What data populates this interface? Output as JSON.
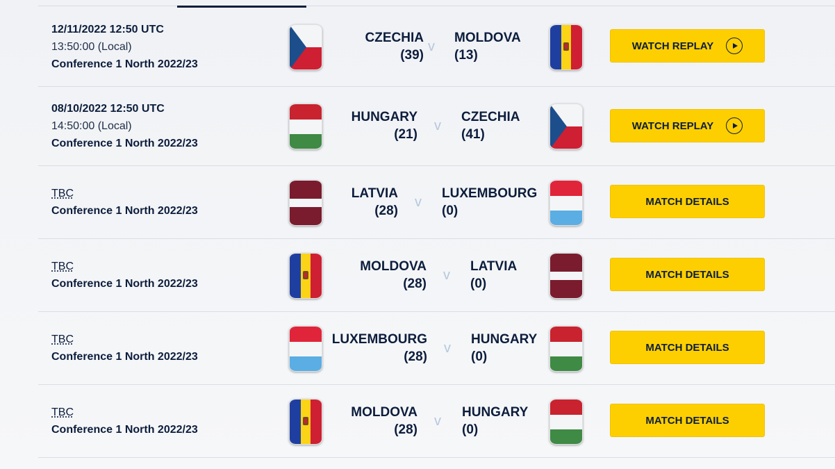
{
  "colors": {
    "button": "#fecf00",
    "text": "#0c1d3c",
    "vs": "#b6c8dd"
  },
  "fixtures": [
    {
      "date": "12/11/2022 12:50 UTC",
      "local": "13:50:00 (Local)",
      "competition": "Conference 1 North 2022/23",
      "home": {
        "name": "CZECHIA",
        "score": "(39)",
        "flag": "czechia-flag"
      },
      "vs": "v",
      "away": {
        "name": "MOLDOVA",
        "score": "(13)",
        "flag": "moldova-flag"
      },
      "button": "WATCH REPLAY",
      "button_icon": "play-icon"
    },
    {
      "date": "08/10/2022 12:50 UTC",
      "local": "14:50:00 (Local)",
      "competition": "Conference 1 North 2022/23",
      "home": {
        "name": "HUNGARY",
        "score": "(21)",
        "flag": "hungary-flag"
      },
      "vs": "v",
      "away": {
        "name": "CZECHIA",
        "score": "(41)",
        "flag": "czechia-flag"
      },
      "button": "WATCH REPLAY",
      "button_icon": "play-icon"
    },
    {
      "date": "TBC",
      "competition": "Conference 1 North 2022/23",
      "home": {
        "name": "LATVIA",
        "score": "(28)",
        "flag": "latvia-flag"
      },
      "vs": "v",
      "away": {
        "name": "LUXEMBOURG",
        "score": "(0)",
        "flag": "luxembourg-flag"
      },
      "button": "MATCH DETAILS"
    },
    {
      "date": "TBC",
      "competition": "Conference 1 North 2022/23",
      "home": {
        "name": "MOLDOVA",
        "score": "(28)",
        "flag": "moldova-flag"
      },
      "vs": "v",
      "away": {
        "name": "LATVIA",
        "score": "(0)",
        "flag": "latvia-flag"
      },
      "button": "MATCH DETAILS"
    },
    {
      "date": "TBC",
      "competition": "Conference 1 North 2022/23",
      "home": {
        "name": "LUXEMBOURG",
        "score": "(28)",
        "flag": "luxembourg-flag"
      },
      "vs": "v",
      "away": {
        "name": "HUNGARY",
        "score": "(0)",
        "flag": "hungary-flag"
      },
      "button": "MATCH DETAILS"
    },
    {
      "date": "TBC",
      "competition": "Conference 1 North 2022/23",
      "home": {
        "name": "MOLDOVA",
        "score": "(28)",
        "flag": "moldova-flag"
      },
      "vs": "v",
      "away": {
        "name": "HUNGARY",
        "score": "(0)",
        "flag": "hungary-flag"
      },
      "button": "MATCH DETAILS"
    }
  ]
}
